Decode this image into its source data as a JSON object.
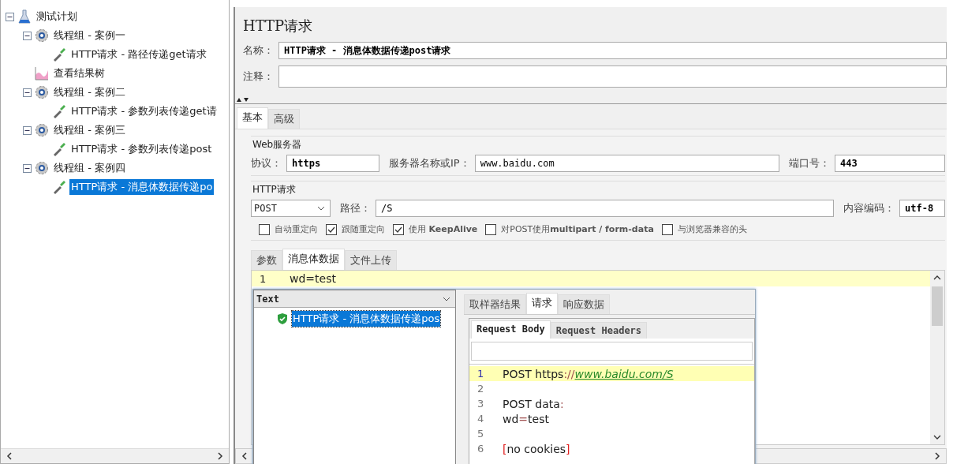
{
  "tree": {
    "label": "测试计划",
    "kind": "plan",
    "expanded": true,
    "selected": false,
    "children": [
      {
        "label": "线程组 - 案例一",
        "kind": "group",
        "expanded": true,
        "selected": false,
        "children": [
          {
            "label": "HTTP请求 - 路径传递get请求",
            "kind": "sampler",
            "selected": false
          }
        ]
      },
      {
        "label": "查看结果树",
        "kind": "listener",
        "selected": false
      },
      {
        "label": "线程组 - 案例二",
        "kind": "group",
        "expanded": true,
        "selected": false,
        "children": [
          {
            "label": "HTTP请求 - 参数列表传递get请",
            "kind": "sampler",
            "selected": false
          }
        ]
      },
      {
        "label": "线程组 - 案例三",
        "kind": "group",
        "expanded": true,
        "selected": false,
        "children": [
          {
            "label": "HTTP请求 - 参数列表传递post",
            "kind": "sampler",
            "selected": false
          }
        ]
      },
      {
        "label": "线程组 - 案例四",
        "kind": "group",
        "expanded": true,
        "selected": false,
        "children": [
          {
            "label": "HTTP请求 - 消息体数据传递po",
            "kind": "sampler",
            "selected": true
          }
        ]
      }
    ]
  },
  "panel": {
    "title": "HTTP请求",
    "name_label": "名称：",
    "name_value": "HTTP请求 - 消息体数据传递post请求",
    "comment_label": "注释：",
    "tabs": [
      {
        "label": "基本",
        "selected": true
      },
      {
        "label": "高级",
        "selected": false
      }
    ],
    "web_server": {
      "legend": "Web服务器",
      "protocol_label": "协议：",
      "protocol": "https",
      "server_label": "服务器名称或IP：",
      "server": "www.baidu.com",
      "port_label": "端口号：",
      "port": "443"
    },
    "http_request": {
      "legend": "HTTP请求",
      "method": "POST",
      "path_label": "路径：",
      "path": "/S",
      "encoding_label": "内容编码：",
      "encoding": "utf-8",
      "options": [
        {
          "label": "自动重定向",
          "checked": false
        },
        {
          "label": "跟随重定向",
          "checked": true
        },
        {
          "label": "使用 **KeepAlive**",
          "checked": true
        },
        {
          "label": "对POST使用**multipart / form-data**",
          "checked": false
        },
        {
          "label": "与浏览器兼容的头",
          "checked": false
        }
      ]
    },
    "body_tabs": [
      {
        "label": "参数",
        "selected": false
      },
      {
        "label": "消息体数据",
        "selected": true
      },
      {
        "label": "文件上传",
        "selected": false
      }
    ],
    "body_lines": [
      {
        "number": "1",
        "text": "wd=test",
        "highlighted": true
      }
    ]
  },
  "results": {
    "renderer": "Text",
    "samples": [
      {
        "label": "HTTP请求 - 消息体数据传递pos",
        "kind": "success",
        "selected": true
      }
    ],
    "tabs": [
      {
        "label": "取样器结果",
        "selected": false
      },
      {
        "label": "请求",
        "selected": true
      },
      {
        "label": "响应数据",
        "selected": false
      }
    ],
    "sub_tabs": [
      {
        "label": "Request Body",
        "selected": true
      },
      {
        "label": "Request Headers",
        "selected": false
      }
    ],
    "lines": [
      {
        "number": "1",
        "highlighted": true,
        "segments": [
          {
            "text": "POST https",
            "kind": "plain"
          },
          {
            "text": "://",
            "kind": "punct"
          },
          {
            "text": "www.baidu.com/S",
            "kind": "link"
          }
        ]
      },
      {
        "number": "2",
        "highlighted": false
      },
      {
        "number": "3",
        "highlighted": false,
        "segments": [
          {
            "text": "POST data",
            "kind": "plain"
          },
          {
            "text": ":",
            "kind": "punct"
          }
        ]
      },
      {
        "number": "4",
        "highlighted": false,
        "segments": [
          {
            "text": "wd",
            "kind": "plain"
          },
          {
            "text": "=",
            "kind": "punct"
          },
          {
            "text": "test",
            "kind": "plain"
          }
        ]
      },
      {
        "number": "5",
        "highlighted": false
      },
      {
        "number": "6",
        "highlighted": false,
        "segments": [
          {
            "text": "[",
            "kind": "bracket"
          },
          {
            "text": "no cookies",
            "kind": "plain"
          },
          {
            "text": "]",
            "kind": "bracket"
          }
        ]
      }
    ]
  }
}
